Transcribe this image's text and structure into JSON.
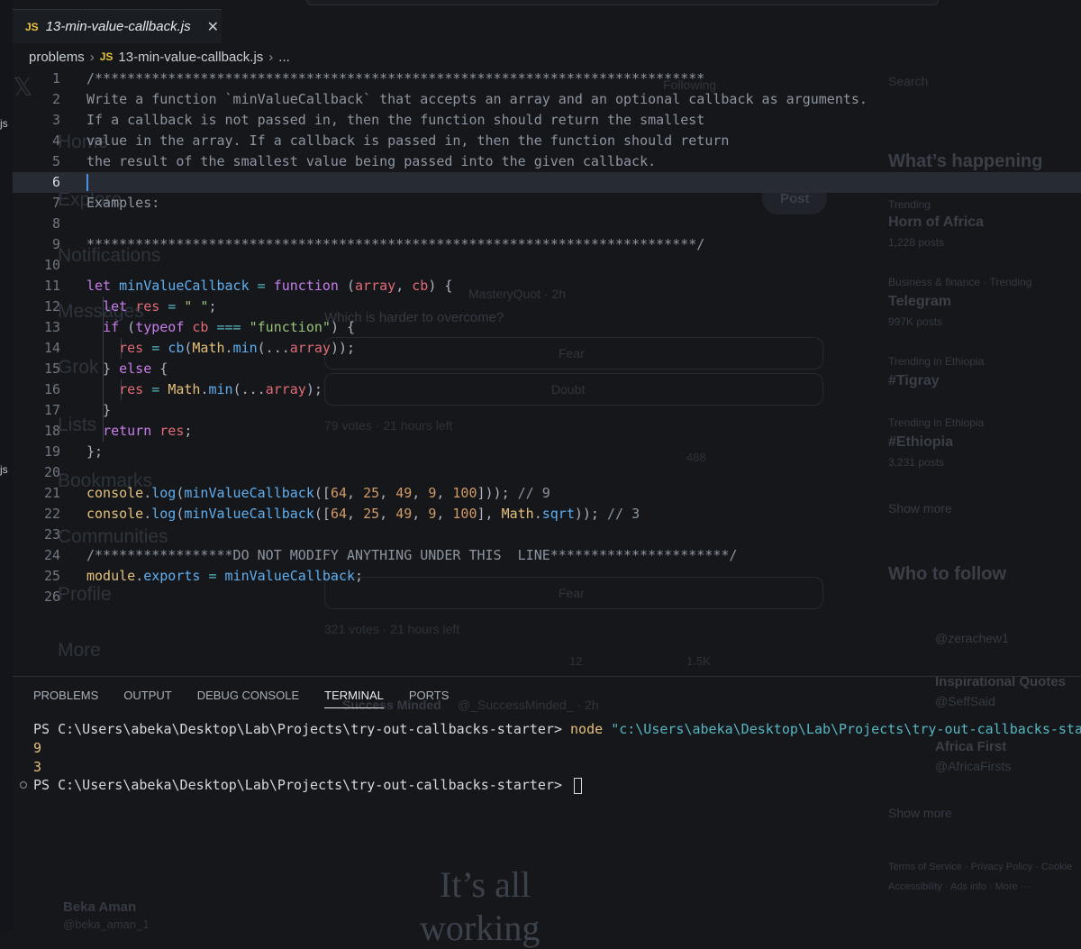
{
  "tab": {
    "badge": "JS",
    "title": "13-min-value-callback.js",
    "close": "✕"
  },
  "breadcrumb": {
    "folder": "problems",
    "badge": "JS",
    "file": "13-min-value-callback.js",
    "more": "..."
  },
  "left_strip": {
    "items": [
      "js",
      "js"
    ]
  },
  "editor": {
    "current_line": 6,
    "lines": [
      {
        "n": "1"
      },
      {
        "n": "2"
      },
      {
        "n": "3"
      },
      {
        "n": "4"
      },
      {
        "n": "5"
      },
      {
        "n": "6"
      },
      {
        "n": "7"
      },
      {
        "n": "8"
      },
      {
        "n": "9"
      },
      {
        "n": "10"
      },
      {
        "n": "11"
      },
      {
        "n": "12"
      },
      {
        "n": "13"
      },
      {
        "n": "14"
      },
      {
        "n": "15"
      },
      {
        "n": "16"
      },
      {
        "n": "17"
      },
      {
        "n": "18"
      },
      {
        "n": "19"
      },
      {
        "n": "20"
      },
      {
        "n": "21"
      },
      {
        "n": "22"
      },
      {
        "n": "23"
      },
      {
        "n": "24"
      },
      {
        "n": "25"
      },
      {
        "n": "26"
      }
    ]
  },
  "panel": {
    "tabs": [
      "PROBLEMS",
      "OUTPUT",
      "DEBUG CONSOLE",
      "TERMINAL",
      "PORTS"
    ],
    "active_tab": "TERMINAL"
  },
  "terminal": {
    "prompt1": "PS C:\\Users\\abeka\\Desktop\\Lab\\Projects\\try-out-callbacks-starter> ",
    "cmd": "node",
    "arg": "\"c:\\Users\\abeka\\Desktop\\Lab\\Projects\\try-out-callbacks-starter\\p",
    "out1": "9",
    "out2": "3",
    "prompt2": "PS C:\\Users\\abeka\\Desktop\\Lab\\Projects\\try-out-callbacks-starter> "
  },
  "ghost": {
    "nav": [
      "Home",
      "Explore",
      "Notifications",
      "Messages",
      "Grok",
      "Lists",
      "Bookmarks",
      "Communities",
      "Profile",
      "More"
    ],
    "search": "Search",
    "following": "Following",
    "post": "Post",
    "happening": "What’s happening",
    "trend1_meta": "Trending",
    "trend1": "Horn of Africa",
    "trend1_count": "1,228 posts",
    "trend2_meta": "Business & finance · Trending",
    "trend2": "Telegram",
    "trend2_count": "997K posts",
    "trend3_meta": "Trending in Ethiopia",
    "trend3": "#Tigray",
    "trend4_meta": "Trending in Ethiopia",
    "trend4": "#Ethiopia",
    "trend4_count": "3,231 posts",
    "show_more": "Show more",
    "who_to_follow": "Who to follow",
    "follow1_handle": "@zerachew1",
    "follow2": "Inspirational Quotes",
    "follow2_handle": "@SeffSaid",
    "follow3": "Africa First",
    "follow3_handle": "@AfricaFirsts",
    "show_more2": "Show more",
    "footer": "Terms of Service · Privacy Policy · Cookie",
    "footer2": "Accessibility · Ads info · More ···",
    "poll_author": "MasteryQuot · 2h",
    "poll_q": "Which is harder to overcome?",
    "opt1": "Fear",
    "opt2": "Doubt",
    "votes1": "79 votes · 21 hours left",
    "opt3": "Fear",
    "votes2": "321 votes · 21 hours left",
    "sm_author": "Success Minded",
    "sm_handle": "@_SuccessMinded_ · 2h",
    "big_text1": "It’s all",
    "big_text2": "working",
    "profile_name": "Beka Aman",
    "profile_handle": "@beka_aman_1",
    "stat1": "1.5K",
    "stat2": "488",
    "stat3": "12"
  }
}
